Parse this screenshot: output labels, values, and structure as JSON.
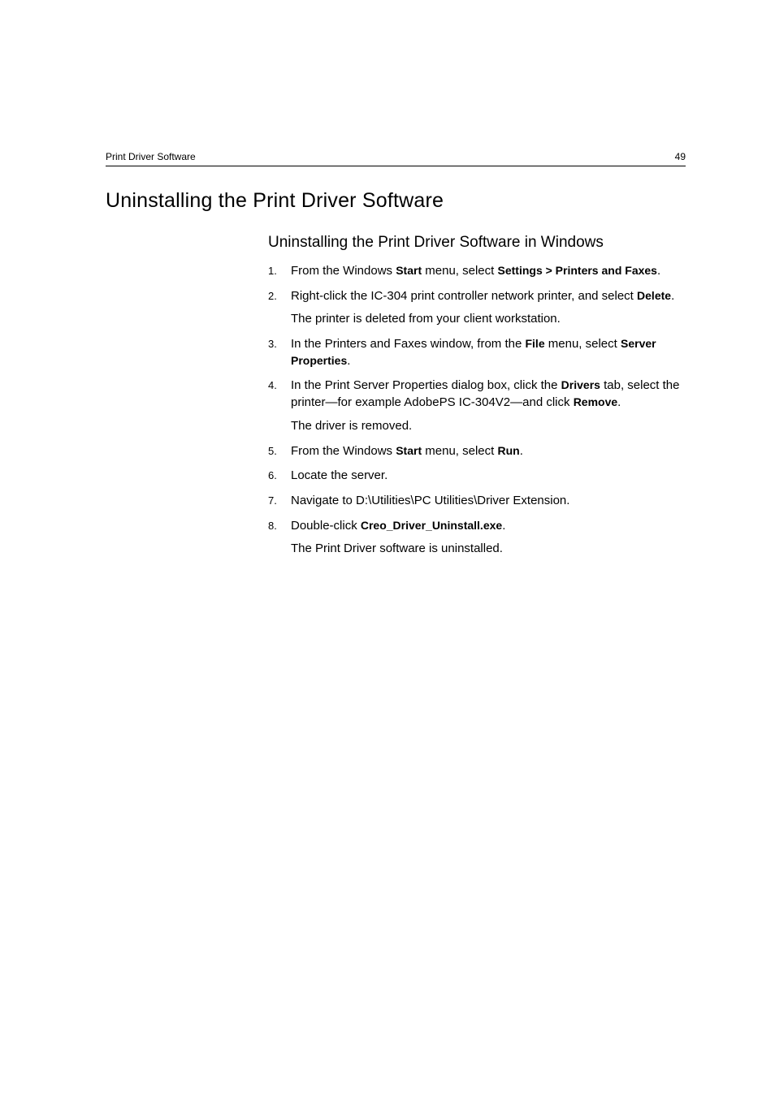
{
  "header": {
    "section": "Print Driver Software",
    "page_number": "49"
  },
  "title": "Uninstalling the Print Driver Software",
  "subtitle": "Uninstalling the Print Driver Software in Windows",
  "steps": [
    {
      "pre1": "From the Windows ",
      "b1": "Start",
      "mid1": " menu, select ",
      "b2": "Settings > Printers and Faxes",
      "post1": "."
    },
    {
      "pre1": "Right-click the IC-304 print controller network printer, and select ",
      "b1": "Delete",
      "post1": ".",
      "result": "The printer is deleted from your client workstation."
    },
    {
      "pre1": "In the Printers and Faxes window, from the ",
      "b1": "File",
      "mid1": " menu, select ",
      "b2": "Server Properties",
      "post1": "."
    },
    {
      "pre1": "In the Print Server Properties dialog box, click the ",
      "b1": "Drivers",
      "mid1": " tab, select the printer—for example AdobePS IC-304V2—and click ",
      "b2": "Remove",
      "post1": ".",
      "result": "The driver is removed."
    },
    {
      "pre1": "From the Windows ",
      "b1": "Start",
      "mid1": " menu, select ",
      "b2": "Run",
      "post1": "."
    },
    {
      "pre1": "Locate the server."
    },
    {
      "pre1": "Navigate to D:\\Utilities\\PC Utilities\\Driver Extension."
    },
    {
      "pre1": "Double-click ",
      "b1": "Creo_Driver_Uninstall.exe",
      "post1": ".",
      "result": "The Print Driver software is uninstalled."
    }
  ]
}
